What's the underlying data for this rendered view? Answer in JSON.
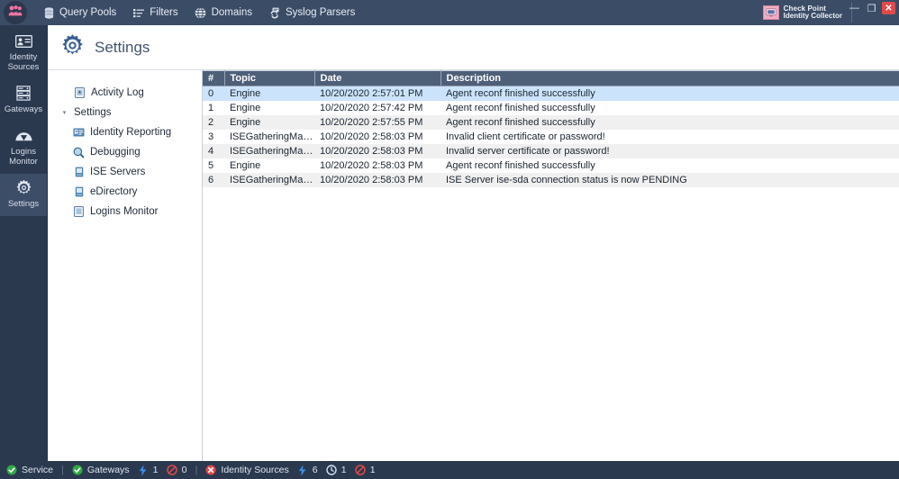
{
  "titlebar": {
    "app_logo_icon": "users-group-icon",
    "menu": [
      {
        "label": "Query Pools",
        "icon": "database-icon"
      },
      {
        "label": "Filters",
        "icon": "filter-list-icon"
      },
      {
        "label": "Domains",
        "icon": "globe-icon"
      },
      {
        "label": "Syslog Parsers",
        "icon": "syslog-parser-icon"
      }
    ],
    "brand": {
      "line1": "Check Point",
      "line2": "Identity Collector",
      "icon": "checkpoint-monitor-icon"
    },
    "window_controls": {
      "minimize": "—",
      "restore": "❐",
      "close": "✕"
    }
  },
  "rail": {
    "items": [
      {
        "label_line1": "Identity",
        "label_line2": "Sources",
        "icon": "identity-card-icon",
        "active": false
      },
      {
        "label_line1": "Gateways",
        "label_line2": "",
        "icon": "server-rack-icon",
        "active": false
      },
      {
        "label_line1": "Logins",
        "label_line2": "Monitor",
        "icon": "gauge-icon",
        "active": false
      },
      {
        "label_line1": "Settings",
        "label_line2": "",
        "icon": "gear-icon",
        "active": true
      }
    ]
  },
  "page": {
    "title": "Settings",
    "title_icon": "gear-icon"
  },
  "tree": {
    "nodes": [
      {
        "label": "Activity Log",
        "level": 1,
        "icon": "activity-log-icon",
        "twisty": ""
      },
      {
        "label": "Settings",
        "level": 1,
        "icon": "",
        "twisty": "▾"
      },
      {
        "label": "Identity Reporting",
        "level": 2,
        "icon": "identity-card-icon",
        "twisty": ""
      },
      {
        "label": "Debugging",
        "level": 2,
        "icon": "magnifier-icon",
        "twisty": ""
      },
      {
        "label": "ISE Servers",
        "level": 2,
        "icon": "server-icon",
        "twisty": ""
      },
      {
        "label": "eDirectory",
        "level": 2,
        "icon": "server-icon",
        "twisty": ""
      },
      {
        "label": "Logins Monitor",
        "level": 2,
        "icon": "clipboard-icon",
        "twisty": ""
      }
    ]
  },
  "table": {
    "columns": [
      "#",
      "Topic",
      "Date",
      "Description"
    ],
    "rows": [
      {
        "n": "0",
        "topic": "Engine",
        "date": "10/20/2020 2:57:01 PM",
        "description": "Agent reconf finished successfully",
        "selected": true
      },
      {
        "n": "1",
        "topic": "Engine",
        "date": "10/20/2020 2:57:42 PM",
        "description": "Agent reconf finished successfully",
        "selected": false
      },
      {
        "n": "2",
        "topic": "Engine",
        "date": "10/20/2020 2:57:55 PM",
        "description": "Agent reconf finished successfully",
        "selected": false
      },
      {
        "n": "3",
        "topic": "ISEGatheringManager",
        "date": "10/20/2020 2:58:03 PM",
        "description": "Invalid client certificate or password!",
        "selected": false
      },
      {
        "n": "4",
        "topic": "ISEGatheringManager",
        "date": "10/20/2020 2:58:03 PM",
        "description": "Invalid server certificate or password!",
        "selected": false
      },
      {
        "n": "5",
        "topic": "Engine",
        "date": "10/20/2020 2:58:03 PM",
        "description": "Agent reconf finished successfully",
        "selected": false
      },
      {
        "n": "6",
        "topic": "ISEGatheringManager",
        "date": "10/20/2020 2:58:03 PM",
        "description": "ISE Server ise-sda connection status is now PENDING",
        "selected": false
      }
    ]
  },
  "statusbar": {
    "service": {
      "label": "Service",
      "icon": "check-circle-green-icon"
    },
    "gateways": {
      "label": "Gateways",
      "icon": "check-circle-green-icon"
    },
    "gateways_bolt": {
      "icon": "bolt-icon",
      "value": "1"
    },
    "gateways_blocked": {
      "icon": "blocked-icon",
      "value": "0"
    },
    "identity_sources": {
      "label": "Identity Sources",
      "icon": "error-circle-red-icon"
    },
    "sources_bolt": {
      "icon": "bolt-icon",
      "value": "6"
    },
    "sources_clock": {
      "icon": "clock-icon",
      "value": "1"
    },
    "sources_blocked": {
      "icon": "blocked-icon",
      "value": "1"
    },
    "separator": "|"
  },
  "colors": {
    "titlebar_bg": "#3b4c66",
    "rail_bg": "#2b394f",
    "header_bg": "#4e5f78",
    "selection_bg": "#cce4fb",
    "accent_pink": "#f0749f",
    "green": "#2faa46",
    "red": "#e04a4a",
    "bolt_blue": "#3a8ee6"
  }
}
